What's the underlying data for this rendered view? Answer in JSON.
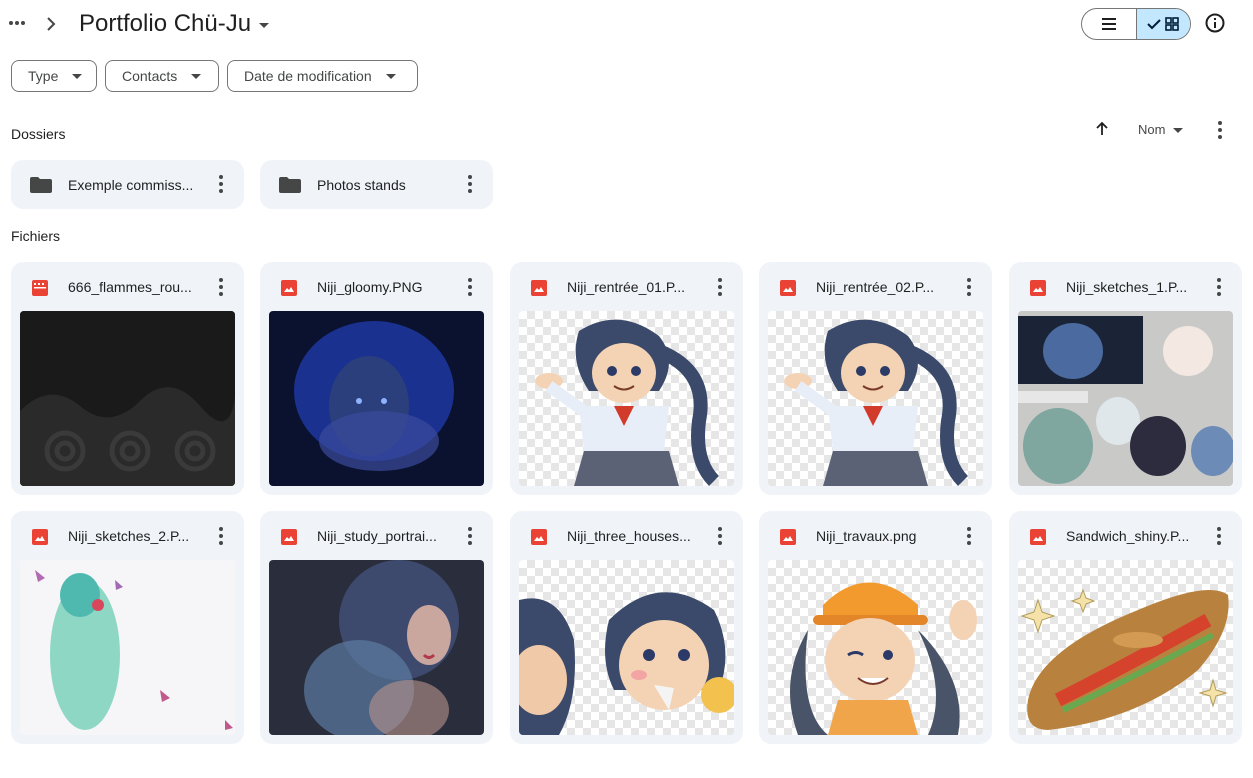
{
  "header": {
    "title": "Portfolio Chü-Ju"
  },
  "filters": [
    {
      "label": "Type"
    },
    {
      "label": "Contacts"
    },
    {
      "label": "Date de modification"
    }
  ],
  "sections": {
    "folders": "Dossiers",
    "files": "Fichiers"
  },
  "sort": {
    "label": "Nom"
  },
  "folders": [
    {
      "name": "Exemple commiss..."
    },
    {
      "name": "Photos stands"
    }
  ],
  "files": [
    {
      "name": "666_flammes_rou...",
      "type_icon": "video-icon"
    },
    {
      "name": "Niji_gloomy.PNG",
      "type_icon": "image-icon"
    },
    {
      "name": "Niji_rentrée_01.P...",
      "type_icon": "image-icon"
    },
    {
      "name": "Niji_rentrée_02.P...",
      "type_icon": "image-icon"
    },
    {
      "name": "Niji_sketches_1.P...",
      "type_icon": "image-icon"
    },
    {
      "name": "Niji_sketches_2.P...",
      "type_icon": "image-icon"
    },
    {
      "name": "Niji_study_portrai...",
      "type_icon": "image-icon"
    },
    {
      "name": "Niji_three_houses...",
      "type_icon": "image-icon"
    },
    {
      "name": "Niji_travaux.png",
      "type_icon": "image-icon"
    },
    {
      "name": "Sandwich_shiny.P...",
      "type_icon": "image-icon"
    }
  ],
  "colors": {
    "accent_selected": "#c2e7ff",
    "card_bg": "#f0f4f9",
    "file_image_icon": "#ea4335",
    "folder_icon": "#444746"
  }
}
